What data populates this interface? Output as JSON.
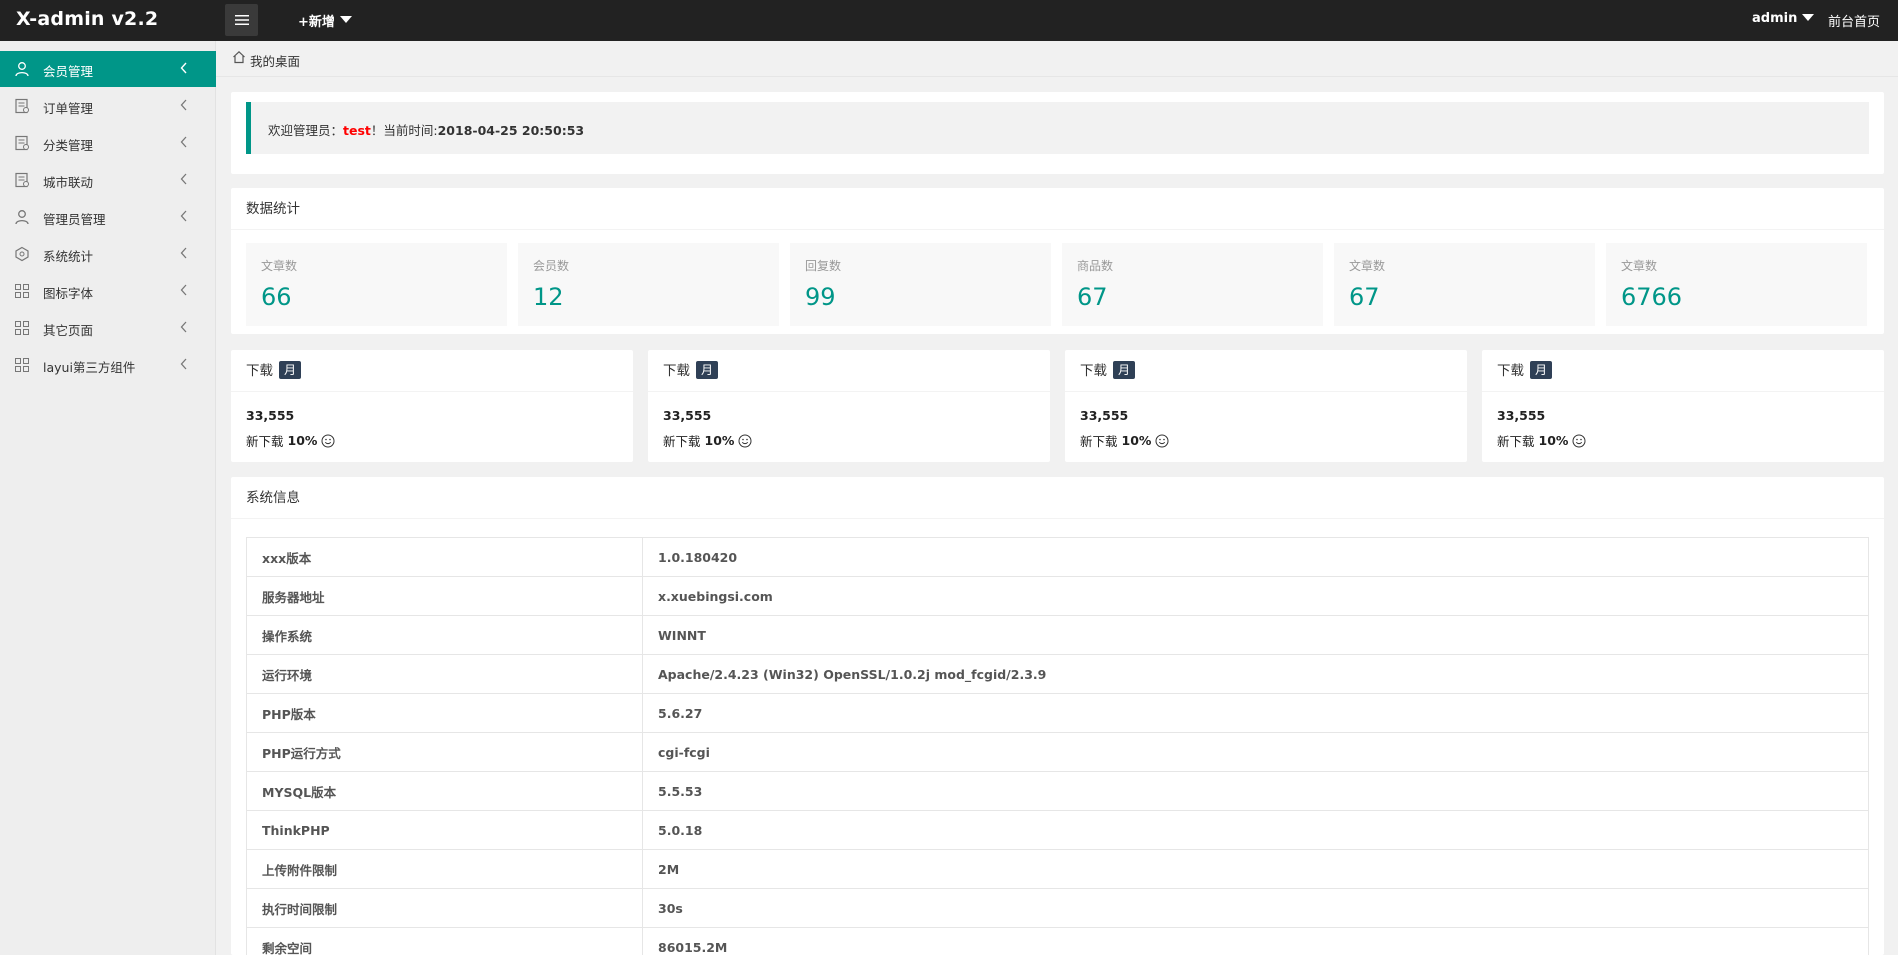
{
  "header": {
    "logo": "X-admin v2.2",
    "add_new": "+新增",
    "admin": "admin",
    "front_home": "前台首页"
  },
  "sidebar": {
    "items": [
      {
        "label": "会员管理",
        "icon": "user-icon"
      },
      {
        "label": "订单管理",
        "icon": "order-icon"
      },
      {
        "label": "分类管理",
        "icon": "category-icon"
      },
      {
        "label": "城市联动",
        "icon": "city-icon"
      },
      {
        "label": "管理员管理",
        "icon": "admin-user-icon"
      },
      {
        "label": "系统统计",
        "icon": "stats-icon"
      },
      {
        "label": "图标字体",
        "icon": "grid-icon"
      },
      {
        "label": "其它页面",
        "icon": "grid-icon"
      },
      {
        "label": "layui第三方组件",
        "icon": "grid-icon"
      }
    ]
  },
  "breadcrumb": {
    "label": "我的桌面"
  },
  "welcome": {
    "prefix": "欢迎管理员：",
    "user": "test",
    "middle": "！当前时间:",
    "time": "2018-04-25 20:50:53"
  },
  "stats": {
    "title": "数据统计",
    "items": [
      {
        "label": "文章数",
        "value": "66"
      },
      {
        "label": "会员数",
        "value": "12"
      },
      {
        "label": "回复数",
        "value": "99"
      },
      {
        "label": "商品数",
        "value": "67"
      },
      {
        "label": "文章数",
        "value": "67"
      },
      {
        "label": "文章数",
        "value": "6766"
      }
    ]
  },
  "downloads": [
    {
      "title": "下载",
      "badge": "月",
      "value": "33,555",
      "new_label": "新下载",
      "new_pct": "10%"
    },
    {
      "title": "下载",
      "badge": "月",
      "value": "33,555",
      "new_label": "新下载",
      "new_pct": "10%"
    },
    {
      "title": "下载",
      "badge": "月",
      "value": "33,555",
      "new_label": "新下载",
      "new_pct": "10%"
    },
    {
      "title": "下载",
      "badge": "月",
      "value": "33,555",
      "new_label": "新下载",
      "new_pct": "10%"
    }
  ],
  "sysinfo": {
    "title": "系统信息",
    "rows": [
      {
        "key": "xxx版本",
        "value": "1.0.180420"
      },
      {
        "key": "服务器地址",
        "value": "x.xuebingsi.com"
      },
      {
        "key": "操作系统",
        "value": "WINNT"
      },
      {
        "key": "运行环境",
        "value": "Apache/2.4.23 (Win32) OpenSSL/1.0.2j mod_fcgid/2.3.9"
      },
      {
        "key": "PHP版本",
        "value": "5.6.27"
      },
      {
        "key": "PHP运行方式",
        "value": "cgi-fcgi"
      },
      {
        "key": "MYSQL版本",
        "value": "5.5.53"
      },
      {
        "key": "ThinkPHP",
        "value": "5.0.18"
      },
      {
        "key": "上传附件限制",
        "value": "2M"
      },
      {
        "key": "执行时间限制",
        "value": "30s"
      },
      {
        "key": "剩余空间",
        "value": "86015.2M"
      }
    ]
  },
  "colors": {
    "accent": "#009688",
    "header_bg": "#222222",
    "badge_bg": "#2f4056",
    "highlight": "#ff0000"
  }
}
